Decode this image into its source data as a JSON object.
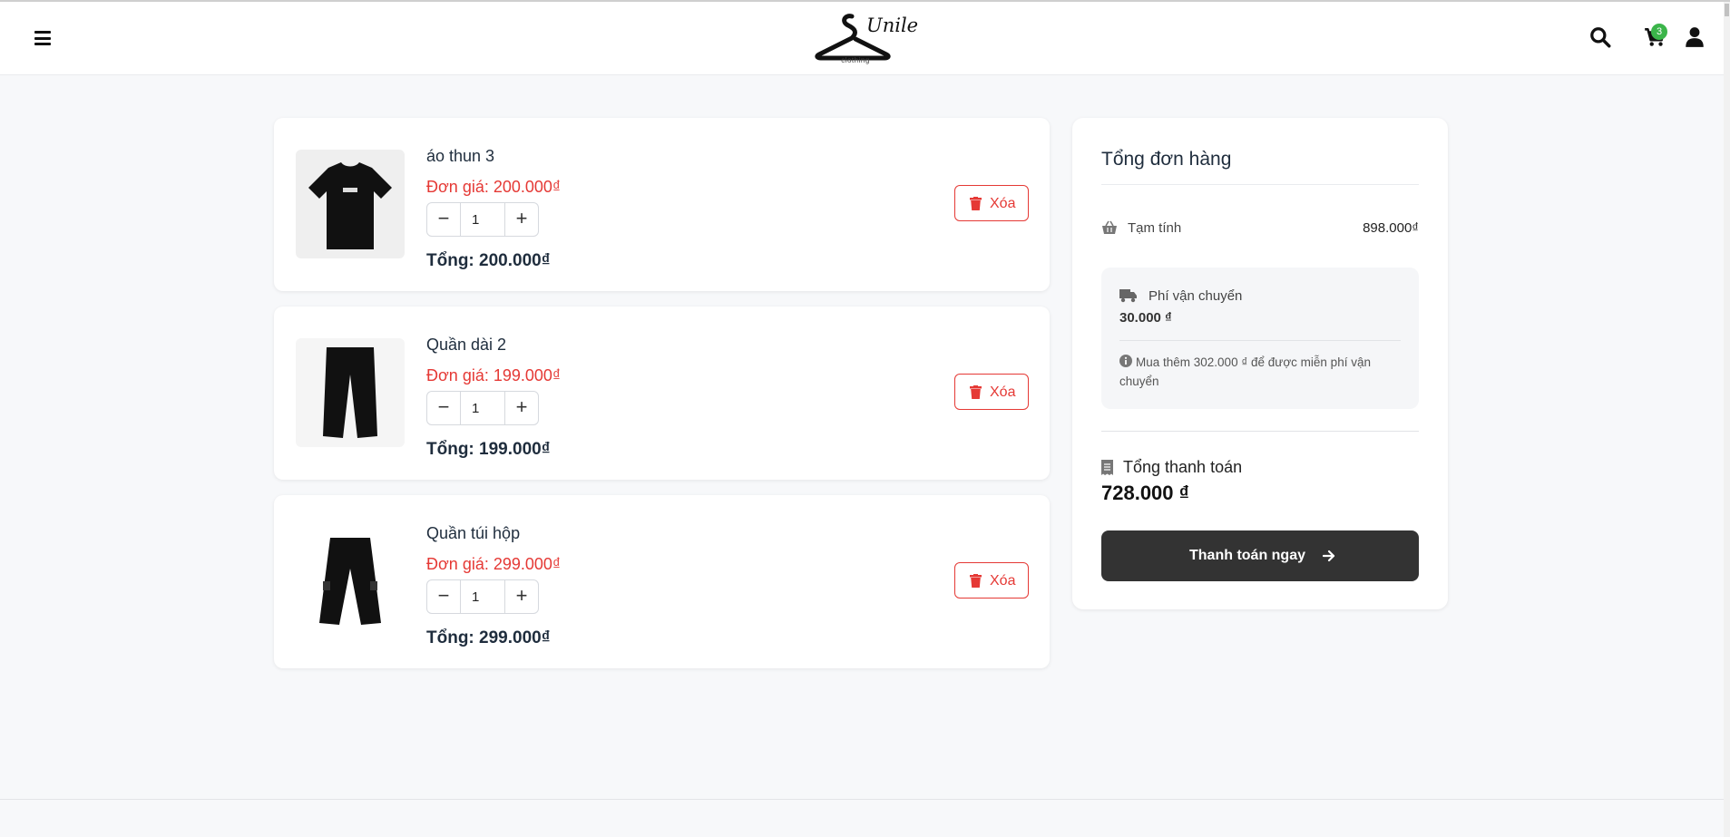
{
  "header": {
    "logo": {
      "script_text": "Unile",
      "sub_text": "clothing"
    },
    "cart_count": "3"
  },
  "cart": {
    "items": [
      {
        "name": "áo thun 3",
        "unit_price": "Đơn giá: 200.000₫",
        "quantity": "1",
        "total": "Tổng: 200.000₫",
        "delete_label": "Xóa"
      },
      {
        "name": "Quần dài 2",
        "unit_price": "Đơn giá: 199.000₫",
        "quantity": "1",
        "total": "Tổng: 199.000₫",
        "delete_label": "Xóa"
      },
      {
        "name": "Quần túi hộp",
        "unit_price": "Đơn giá: 299.000₫",
        "quantity": "1",
        "total": "Tổng: 299.000₫",
        "delete_label": "Xóa"
      }
    ]
  },
  "summary": {
    "title": "Tổng đơn hàng",
    "subtotal_label": "Tạm tính",
    "subtotal_value": "898.000₫",
    "shipping_label": "Phí vận chuyển",
    "shipping_fee": "30.000 ₫",
    "shipping_note": "Mua thêm 302.000 ₫ để được miễn phí vận chuyển",
    "total_label": "Tổng thanh toán",
    "total_value": "728.000 ₫",
    "checkout_label": "Thanh toán ngay"
  },
  "colors": {
    "price_red": "#e53935",
    "badge_green": "#3bb54a",
    "checkout_bg": "#333333"
  }
}
